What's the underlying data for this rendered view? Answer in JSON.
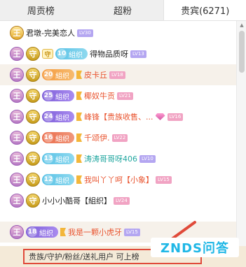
{
  "tabs": [
    {
      "label": "周贡榜"
    },
    {
      "label": "超粉"
    },
    {
      "label": "贵宾(6271)"
    }
  ],
  "rows": [
    {
      "crown_label": "王",
      "name": "君墩-完美恋人",
      "level": "LV30"
    },
    {
      "king": "王",
      "guard": "守",
      "shield": "守",
      "fan_level": "10",
      "fan_label": "組织",
      "name": "得物品质呀",
      "level": "LV13"
    },
    {
      "king": "王",
      "guard": "守",
      "fan_level": "20",
      "fan_label": "組织",
      "name": "皮卡丘",
      "level": "LV18"
    },
    {
      "king": "王",
      "guard": "守",
      "fan_level": "25",
      "fan_label": "組织",
      "name": "椰奴牛贡",
      "level": "LV21"
    },
    {
      "king": "王",
      "guard": "守",
      "fan_level": "24",
      "fan_label": "組织",
      "name": "峰锋【贵族收售、...",
      "level": "LV16"
    },
    {
      "king": "王",
      "guard": "守",
      "fan_level": "16",
      "fan_label": "組织",
      "name": "千颂伊.",
      "level": "LV22"
    },
    {
      "king": "王",
      "guard": "守",
      "fan_level": "13",
      "fan_label": "組织",
      "name": "涛涛哥哥呀406",
      "level": "LV10"
    },
    {
      "king": "王",
      "guard": "守",
      "fan_level": "12",
      "fan_label": "組织",
      "name": "我叫丫丫呵【小象】",
      "level": "LV15"
    },
    {
      "king": "王",
      "guard": "守",
      "name": "小小小酷哥【組织】",
      "level": "LV24"
    },
    {
      "king": "王",
      "fan_level": "18",
      "fan_label": "組织",
      "name": "我是一颗小虎牙",
      "level": "LV15"
    }
  ],
  "bottom_text": "贵族/守护/粉丝/送礼用户 可上榜",
  "watermark": "ZNDS问答",
  "colors": {
    "accent_red": "#e04a3a",
    "name_red": "#e9542f",
    "watermark_blue": "#1fb7e6"
  }
}
